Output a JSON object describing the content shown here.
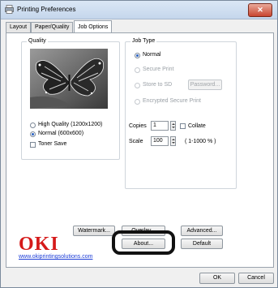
{
  "window": {
    "title": "Printing Preferences",
    "close_symbol": "✕"
  },
  "tabs": [
    {
      "label": "Layout"
    },
    {
      "label": "Paper/Quality"
    },
    {
      "label": "Job Options",
      "active": true
    }
  ],
  "quality": {
    "group_label": "Quality",
    "options": [
      {
        "label": "High Quality (1200x1200)",
        "selected": false
      },
      {
        "label": "Normal (600x600)",
        "selected": true
      }
    ],
    "toner_save_label": "Toner Save"
  },
  "job_type": {
    "group_label": "Job Type",
    "options": [
      {
        "label": "Normal",
        "selected": true,
        "enabled": true
      },
      {
        "label": "Secure Print",
        "selected": false,
        "enabled": false
      },
      {
        "label": "Store to SD",
        "selected": false,
        "enabled": false
      },
      {
        "label": "Encrypted Secure Print",
        "selected": false,
        "enabled": false
      }
    ],
    "password_button": "Password..."
  },
  "copies": {
    "label": "Copies",
    "value": "1",
    "collate_label": "Collate"
  },
  "scale": {
    "label": "Scale",
    "value": "100",
    "range_text": "( 1-1000 % )"
  },
  "buttons": {
    "watermark": "Watermark...",
    "overlay": "Overlay...",
    "advanced": "Advanced...",
    "about": "About...",
    "default": "Default",
    "ok": "OK",
    "cancel": "Cancel"
  },
  "branding": {
    "logo_text": "OKI",
    "logo_color": "#d51a1a",
    "website": "www.okiprintingsolutions.com"
  }
}
